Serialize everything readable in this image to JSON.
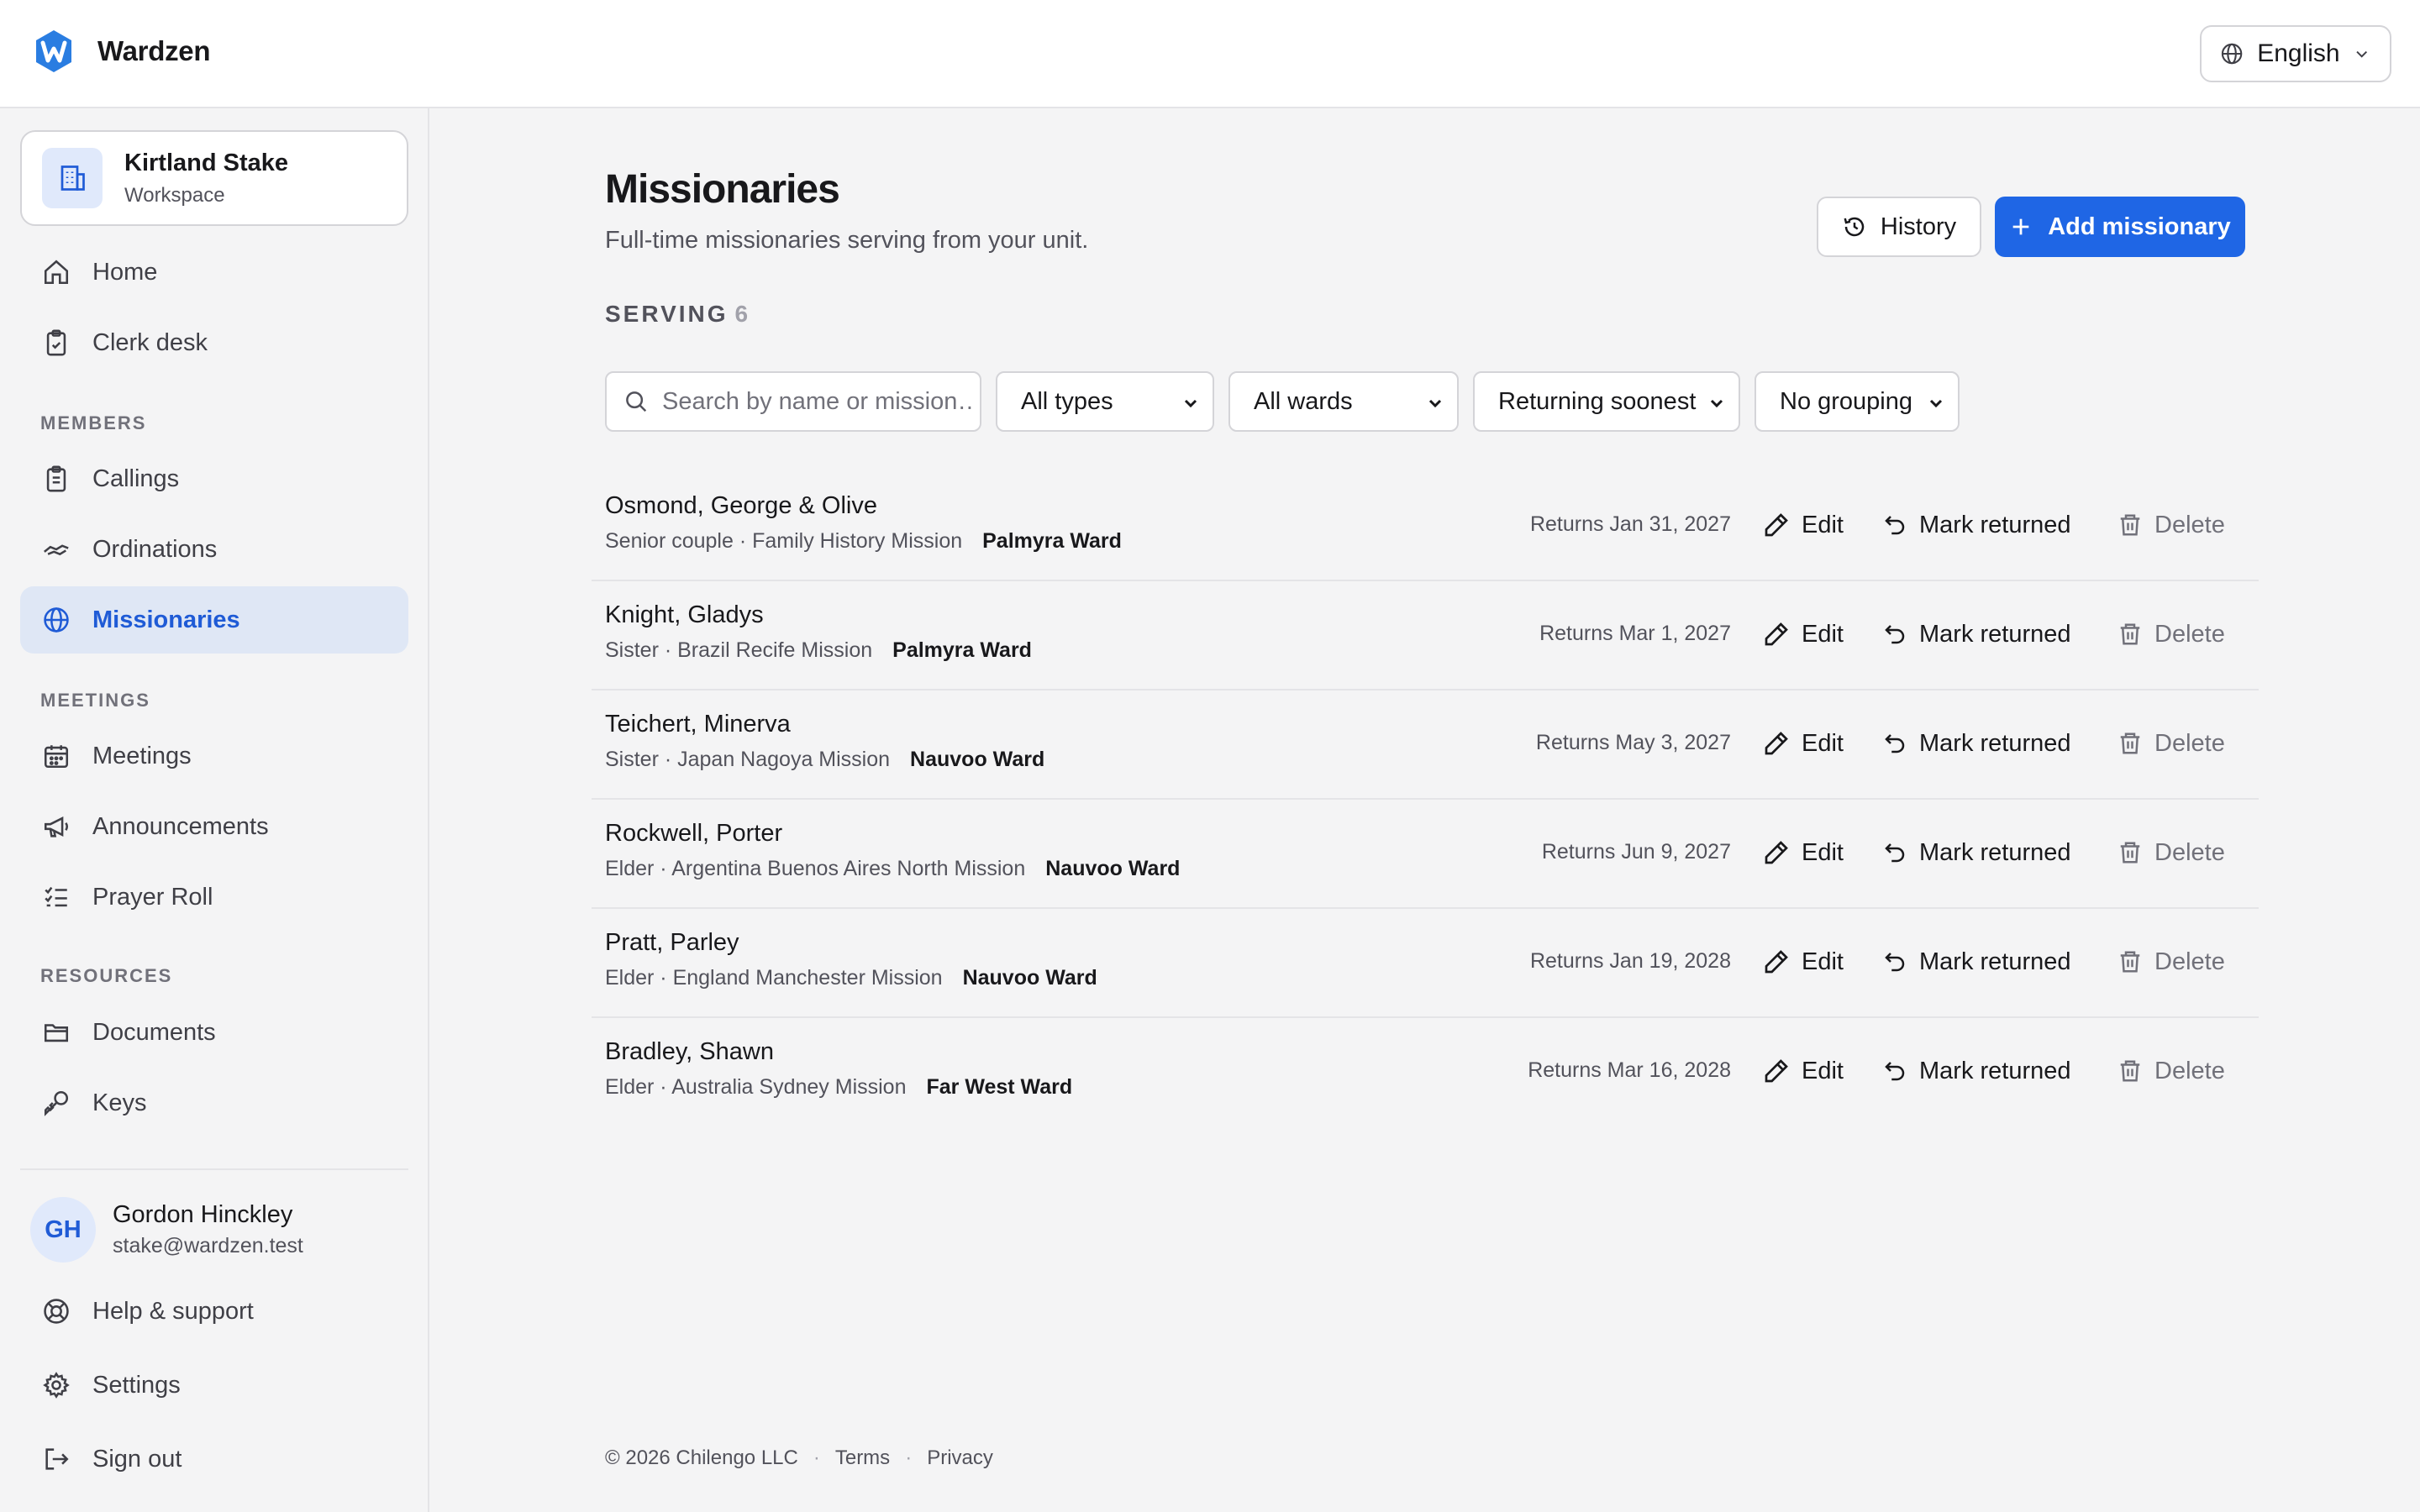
{
  "app": {
    "name": "Wardzen",
    "language": "English"
  },
  "workspace": {
    "name": "Kirtland Stake",
    "sub": "Workspace"
  },
  "sidebar": {
    "top_items": [
      {
        "label": "Home",
        "icon": "home-icon"
      },
      {
        "label": "Clerk desk",
        "icon": "clipboard-check-icon"
      }
    ],
    "sections": {
      "members": "MEMBERS",
      "meetings": "MEETINGS",
      "resources": "RESOURCES"
    },
    "members_items": [
      {
        "label": "Callings",
        "icon": "clipboard-list-icon"
      },
      {
        "label": "Ordinations",
        "icon": "handshake-icon"
      },
      {
        "label": "Missionaries",
        "icon": "globe-icon",
        "active": true
      }
    ],
    "meetings_items": [
      {
        "label": "Meetings",
        "icon": "calendar-icon"
      },
      {
        "label": "Announcements",
        "icon": "megaphone-icon"
      },
      {
        "label": "Prayer Roll",
        "icon": "checklist-icon"
      }
    ],
    "resources_items": [
      {
        "label": "Documents",
        "icon": "folder-icon"
      },
      {
        "label": "Keys",
        "icon": "key-icon"
      }
    ],
    "user": {
      "initials": "GH",
      "name": "Gordon Hinckley",
      "email": "stake@wardzen.test"
    },
    "bottom_items": [
      {
        "label": "Help & support",
        "icon": "lifebuoy-icon"
      },
      {
        "label": "Settings",
        "icon": "gear-icon"
      },
      {
        "label": "Sign out",
        "icon": "sign-out-icon"
      }
    ]
  },
  "main": {
    "title": "Missionaries",
    "subtitle": "Full-time missionaries serving from your unit.",
    "history_label": "History",
    "add_label": "Add missionary",
    "serving_label": "SERVING",
    "serving_count": "6",
    "search_placeholder": "Search by name or mission…",
    "filters": {
      "type": "All types",
      "ward": "All wards",
      "sort": "Returning soonest",
      "group": "No grouping"
    },
    "actions": {
      "edit": "Edit",
      "mark": "Mark returned",
      "delete": "Delete"
    },
    "missionaries": [
      {
        "name": "Osmond, George & Olive",
        "meta": "Senior couple · Family History Mission",
        "ward": "Palmyra Ward",
        "returns": "Returns Jan 31, 2027"
      },
      {
        "name": "Knight, Gladys",
        "meta": "Sister · Brazil Recife Mission",
        "ward": "Palmyra Ward",
        "returns": "Returns Mar 1, 2027"
      },
      {
        "name": "Teichert, Minerva",
        "meta": "Sister · Japan Nagoya Mission",
        "ward": "Nauvoo Ward",
        "returns": "Returns May 3, 2027"
      },
      {
        "name": "Rockwell, Porter",
        "meta": "Elder · Argentina Buenos Aires North Mission",
        "ward": "Nauvoo Ward",
        "returns": "Returns Jun 9, 2027"
      },
      {
        "name": "Pratt, Parley",
        "meta": "Elder · England Manchester Mission",
        "ward": "Nauvoo Ward",
        "returns": "Returns Jan 19, 2028"
      },
      {
        "name": "Bradley, Shawn",
        "meta": "Elder · Australia Sydney Mission",
        "ward": "Far West Ward",
        "returns": "Returns Mar 16, 2028"
      }
    ]
  },
  "footer": {
    "copyright": "© 2026 Chilengo LLC",
    "terms": "Terms",
    "privacy": "Privacy"
  },
  "colors": {
    "accent": "#1f66e5",
    "active_bg": "#dfe7f5",
    "background": "#f4f4f5"
  }
}
